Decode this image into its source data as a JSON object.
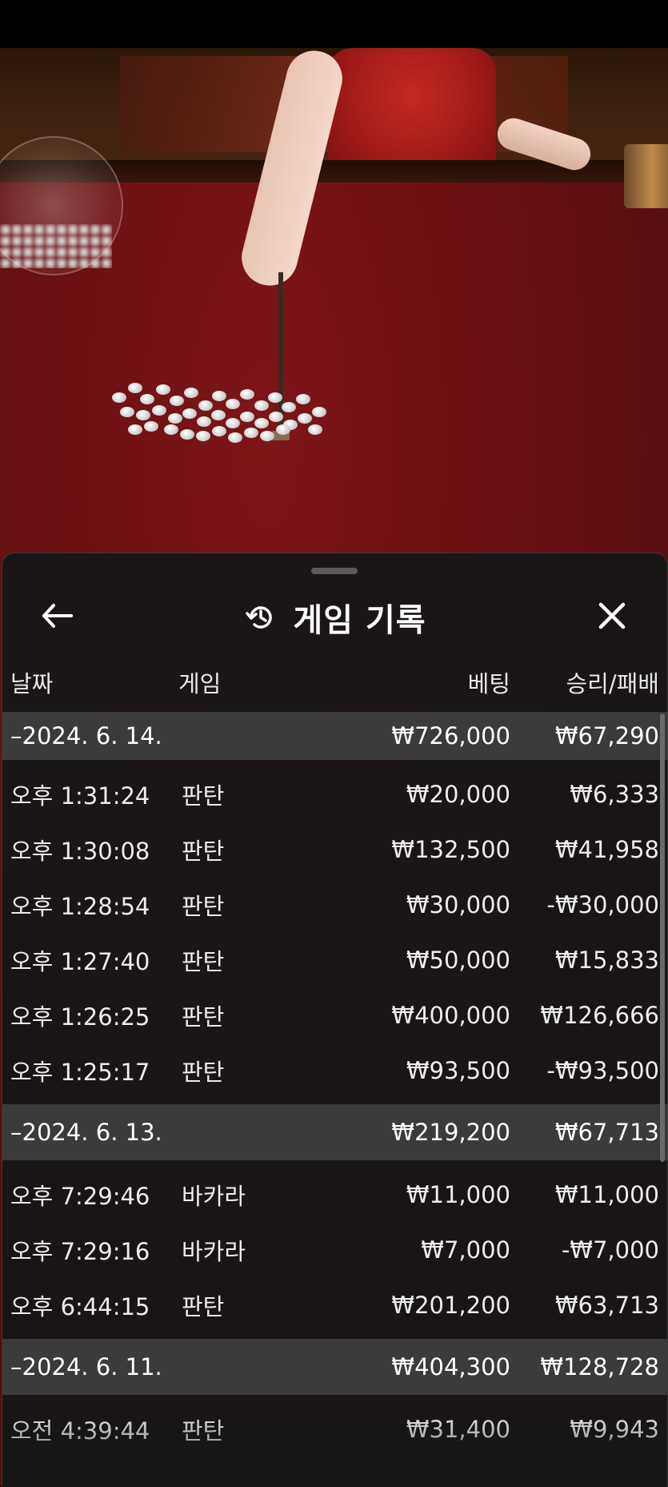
{
  "panel": {
    "title": "게임 기록",
    "back_icon": "arrow-left-icon",
    "history_icon": "history-icon",
    "close_icon": "close-icon"
  },
  "columns": {
    "date": "날짜",
    "game": "게임",
    "bet": "베팅",
    "win_loss": "승리/패배"
  },
  "groups": [
    {
      "date": "–2024. 6. 14.",
      "bet": "₩726,000",
      "win_loss": "₩67,290",
      "rows": [
        {
          "time": "오후 1:31:24",
          "game": "판탄",
          "bet": "₩20,000",
          "win_loss": "₩6,333"
        },
        {
          "time": "오후 1:30:08",
          "game": "판탄",
          "bet": "₩132,500",
          "win_loss": "₩41,958"
        },
        {
          "time": "오후 1:28:54",
          "game": "판탄",
          "bet": "₩30,000",
          "win_loss": "-₩30,000"
        },
        {
          "time": "오후 1:27:40",
          "game": "판탄",
          "bet": "₩50,000",
          "win_loss": "₩15,833"
        },
        {
          "time": "오후 1:26:25",
          "game": "판탄",
          "bet": "₩400,000",
          "win_loss": "₩126,666"
        },
        {
          "time": "오후 1:25:17",
          "game": "판탄",
          "bet": "₩93,500",
          "win_loss": "-₩93,500"
        }
      ]
    },
    {
      "date": "–2024. 6. 13.",
      "bet": "₩219,200",
      "win_loss": "₩67,713",
      "rows": [
        {
          "time": "오후 7:29:46",
          "game": "바카라",
          "bet": "₩11,000",
          "win_loss": "₩11,000"
        },
        {
          "time": "오후 7:29:16",
          "game": "바카라",
          "bet": "₩7,000",
          "win_loss": "-₩7,000"
        },
        {
          "time": "오후 6:44:15",
          "game": "판탄",
          "bet": "₩201,200",
          "win_loss": "₩63,713"
        }
      ]
    },
    {
      "date": "–2024. 6. 11.",
      "bet": "₩404,300",
      "win_loss": "₩128,728",
      "rows": [
        {
          "time": "오전 4:39:44",
          "game": "판탄",
          "bet": "₩31,400",
          "win_loss": "₩9,943"
        }
      ]
    }
  ]
}
